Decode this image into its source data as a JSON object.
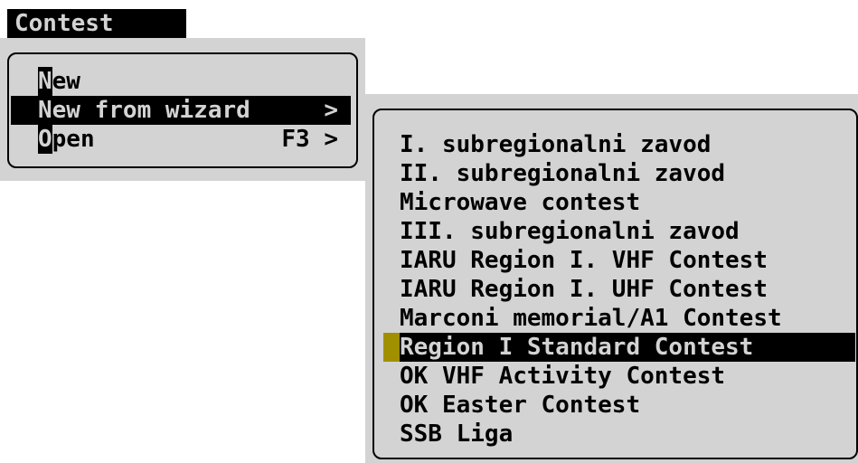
{
  "title": "Contest",
  "menu": {
    "items": [
      {
        "label": "New",
        "hotkey": "N",
        "rest": "ew",
        "shortcut": ""
      },
      {
        "label": "New from wizard",
        "shortcut": ">"
      },
      {
        "label": "Open",
        "hotkey": "O",
        "rest": "pen",
        "shortcut": "F3 >"
      }
    ]
  },
  "submenu": {
    "items": [
      "I. subregionalni zavod",
      "II. subregionalni zavod",
      "Microwave contest",
      "III. subregionalni zavod",
      "IARU Region I. VHF Contest",
      "IARU Region I. UHF Contest",
      "Marconi memorial/A1 Contest",
      "Region I Standard Contest",
      "OK VHF Activity Contest",
      "OK Easter Contest",
      "SSB Liga"
    ],
    "selected_index": 7
  },
  "colors": {
    "panel": "#d3d3d3",
    "highlight": "#000000",
    "cursor": "#a09000"
  }
}
